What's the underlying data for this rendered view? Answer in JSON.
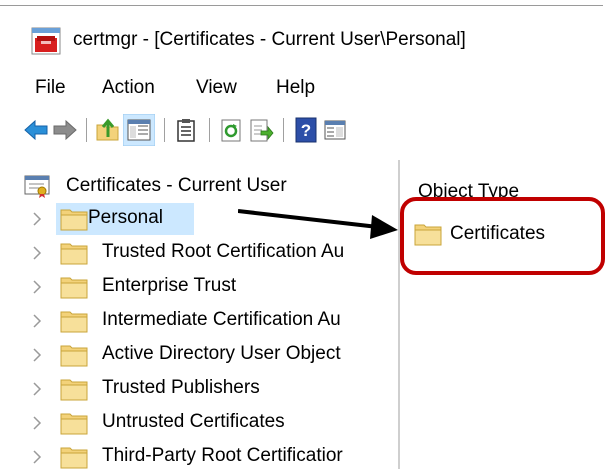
{
  "window": {
    "title": "certmgr - [Certificates - Current User\\Personal]",
    "icon": "certificate-manager-icon"
  },
  "menu": [
    "File",
    "Action",
    "View",
    "Help"
  ],
  "toolbar": {
    "buttons": [
      "back-icon",
      "forward-icon",
      "up-folder-icon",
      "show-hide-console-tree-icon",
      "properties-icon",
      "refresh-icon",
      "export-list-icon",
      "help-icon",
      "action-pane-icon"
    ]
  },
  "tree": {
    "root": "Certificates - Current User",
    "items": [
      "Personal",
      "Trusted Root Certification Au",
      "Enterprise Trust",
      "Intermediate Certification Au",
      "Active Directory User Object",
      "Trusted Publishers",
      "Untrusted Certificates",
      "Third-Party Root Certificatior"
    ],
    "selected_index": 0
  },
  "details": {
    "column_header": "Object Type",
    "items": [
      "Certificates"
    ]
  },
  "annotation": {
    "box_color": "#c00000",
    "arrow_color": "#000000"
  },
  "colors": {
    "selection": "#cce8ff",
    "folder": "#f3d27a"
  }
}
